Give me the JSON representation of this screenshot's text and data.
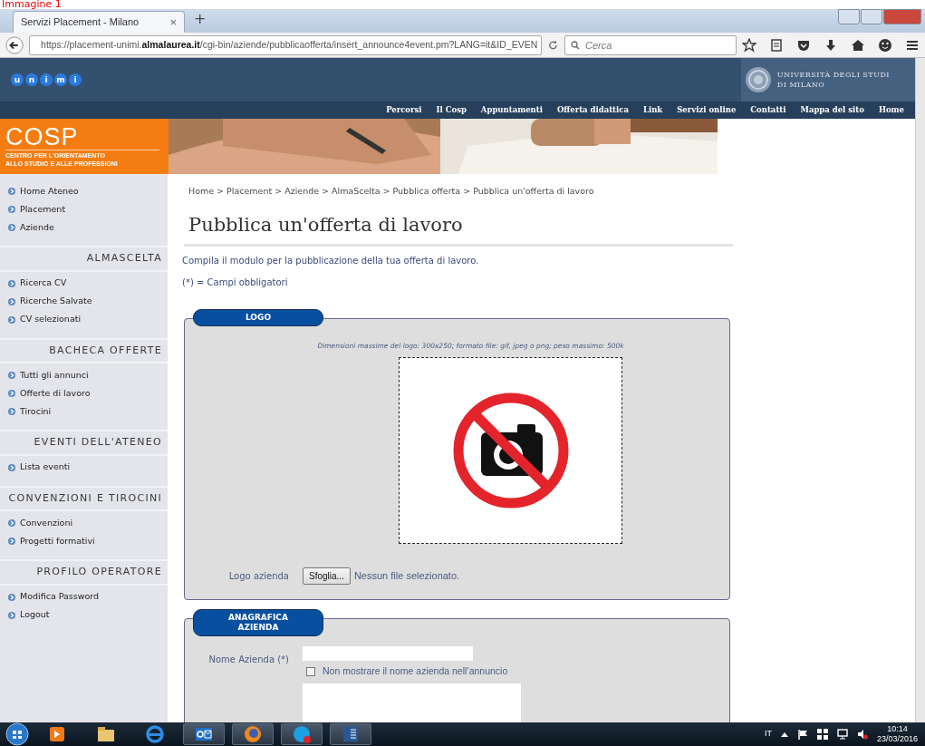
{
  "caption": "Immagine 1",
  "browser": {
    "tabs": [
      {
        "title": "Servizi Placement - Milano",
        "close": "×",
        "selected": true
      }
    ],
    "new_tab": "+",
    "url": "https://placement-unimi.**almalaurea.it**/cgi-bin/aziende/pubblicaofferta/insert_announce4event.pm?LANG=it&ID_EVEN",
    "search": {
      "placeholder": "Cerca"
    }
  },
  "header": {
    "logo_letters": [
      "u",
      "n",
      "i",
      "m",
      "i"
    ],
    "university": [
      "UNIVERSITÀ DEGLI STUDI",
      "DI MILANO"
    ]
  },
  "nav": [
    "Percorsi",
    "Il Cosp",
    "Appuntamenti",
    "Offerta didattica",
    "Link",
    "Servizi online",
    "Contatti",
    "Mappa del sito",
    "Home"
  ],
  "cosp": {
    "title": "COSP",
    "subtitle": [
      "CENTRO PER L'ORIENTAMENTO",
      "ALLO STUDIO E ALLE PROFESSIONI"
    ]
  },
  "sidebar": [
    {
      "items": [
        "Home Ateneo",
        "Placement",
        "Aziende"
      ]
    },
    {
      "heading": "ALMASCELTA",
      "items": [
        "Ricerca CV",
        "Ricerche Salvate",
        "CV selezionati"
      ]
    },
    {
      "heading": "BACHECA OFFERTE",
      "items": [
        "Tutti gli annunci",
        "Offerte di lavoro",
        "Tirocini"
      ]
    },
    {
      "heading": "EVENTI DELL'ATENEO",
      "items": [
        "Lista eventi"
      ]
    },
    {
      "heading": "CONVENZIONI E TIROCINI",
      "items": [
        "Convenzioni",
        "Progetti formativi"
      ]
    },
    {
      "heading": "PROFILO OPERATORE",
      "items": [
        "Modifica Password",
        "Logout"
      ]
    }
  ],
  "breadcrumb": "Home > Placement > Aziende > AlmaScelta > Pubblica offerta > Pubblica un'offerta di lavoro",
  "title": "Pubblica un'offerta di lavoro",
  "intro": "Compila il modulo per la pubblicazione della tua offerta di lavoro.",
  "required_note": "(*) = Campi obbligatori",
  "sections": [
    {
      "legend": "LOGO",
      "kind": "logo",
      "hint": "Dimensioni massime del logo: 300x250; formato file: gif, jpeg o png; peso massimo: 500k",
      "fields": [
        {
          "kind": "file",
          "label": "Logo azienda",
          "button": "Sfoglia...",
          "value": "Nessun file selezionato."
        }
      ]
    },
    {
      "legend": "ANAGRAFICA AZIENDA",
      "kind": "form",
      "fields": [
        {
          "kind": "text",
          "label": "Nome Azienda (*)",
          "checkbox": {
            "label": "Non mostrare il nome azienda nell’annuncio",
            "checked": false
          }
        },
        {
          "kind": "textarea"
        }
      ]
    }
  ],
  "taskbar": {
    "language": "IT",
    "time": "10:14",
    "date": "23/03/2016"
  }
}
